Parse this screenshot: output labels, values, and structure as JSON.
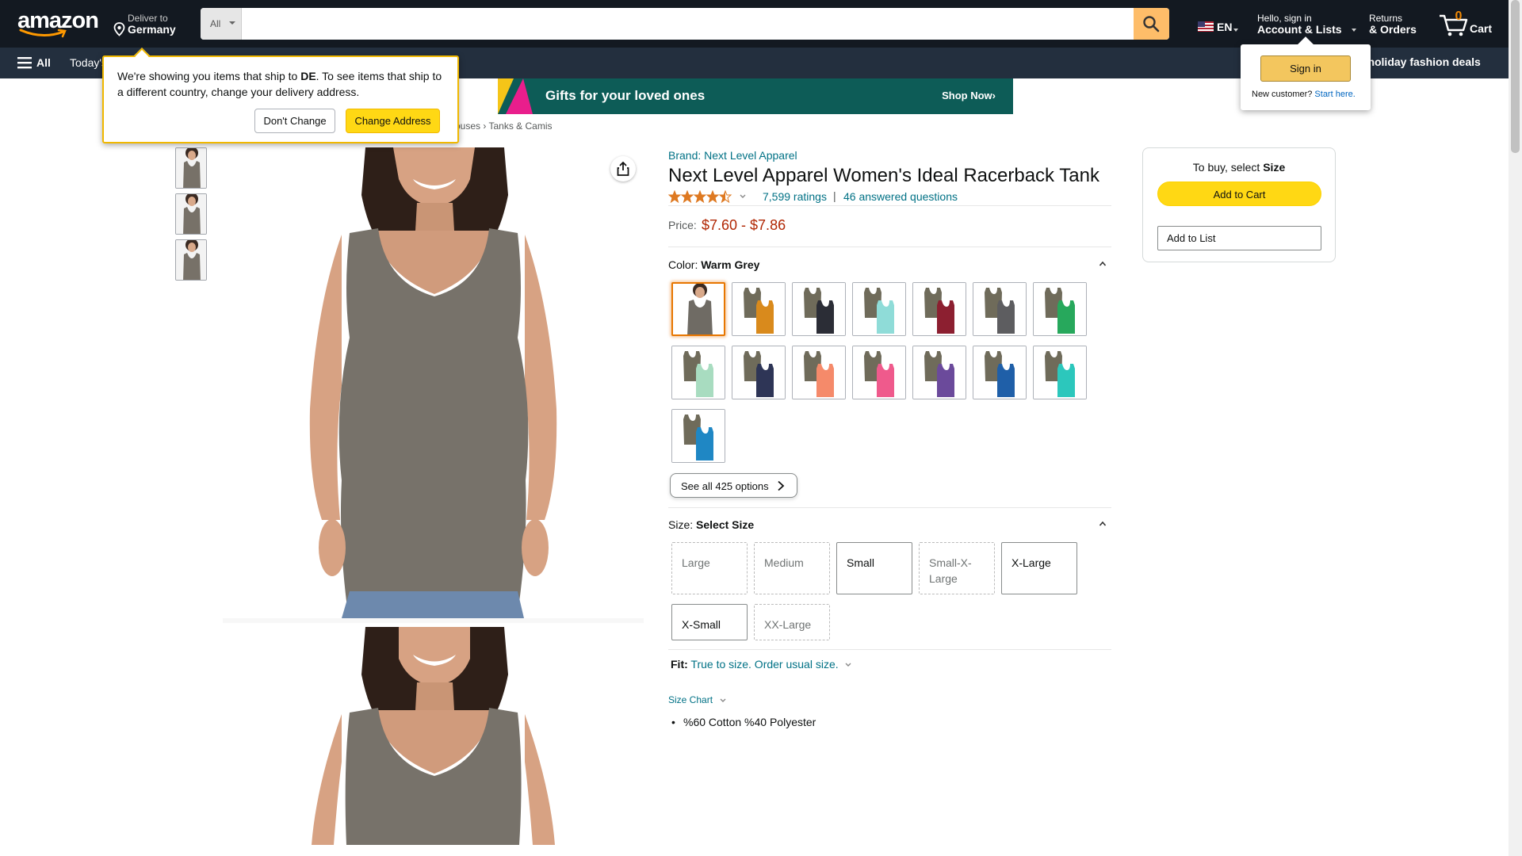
{
  "header": {
    "logo_text": "amazon",
    "deliver_line1": "Deliver to",
    "deliver_line2": "Germany",
    "search_dept": "All",
    "search_placeholder": "",
    "lang": "EN",
    "account_line1": "Hello, sign in",
    "account_line2": "Account & Lists",
    "returns_line1": "Returns",
    "returns_line2": "& Orders",
    "cart_count": "0",
    "cart_label": "Cart"
  },
  "subnav": {
    "all_label": "All",
    "today_label": "Today's",
    "deals_label": "p holiday fashion deals"
  },
  "promo": {
    "text": "Gifts for your loved ones",
    "cta": "Shop Now›"
  },
  "breadcrumb": "ouses › Tanks & Camis",
  "ship_popover": {
    "msg_prefix": "We're showing you items that ship to ",
    "country": "DE",
    "msg_suffix": ". To see items that ship to a different country, change your delivery address.",
    "dont_change": "Don't Change",
    "change_address": "Change Address"
  },
  "signin_popover": {
    "button": "Sign in",
    "new_customer": "New customer?",
    "start_here": "Start here."
  },
  "product": {
    "brand": "Brand: Next Level Apparel",
    "title": "Next Level Apparel Women's Ideal Racerback Tank",
    "rating_stars": 4.5,
    "ratings": "7,599 ratings",
    "separator": "|",
    "questions": "46 answered questions",
    "price_label": "Price:",
    "price": "$7.60 - $7.86",
    "color_label": "Color: ",
    "color_value": "Warm Grey",
    "see_all": "See all 425 options",
    "size_label": "Size: ",
    "size_value": "Select Size",
    "sizes": [
      {
        "label": "Large",
        "available": false
      },
      {
        "label": "Medium",
        "available": false
      },
      {
        "label": "Small",
        "available": true
      },
      {
        "label": "Small-X-Large",
        "available": false
      },
      {
        "label": "X-Large",
        "available": true
      },
      {
        "label": "X-Small",
        "available": true
      },
      {
        "label": "XX-Large",
        "available": false
      }
    ],
    "fit_label": "Fit:",
    "fit_value": "True to size. Order usual size.",
    "size_chart": "Size Chart",
    "material": "%60 Cotton %40 Polyester",
    "swatch_colors": [
      "#6f6b64",
      "#d98a1c",
      "#2b2d36",
      "#8fdcd8",
      "#8c1f30",
      "#5d5d60",
      "#27a85c",
      "#a8dcc0",
      "#2e3556",
      "#f58a6a",
      "#ef5a8c",
      "#6b4a9b",
      "#1f5fa8",
      "#2cc7bc",
      "#1f87c4"
    ]
  },
  "buybox": {
    "hint_prefix": "To buy, select ",
    "hint_bold": "Size",
    "add_to_cart": "Add to Cart",
    "add_to_list": "Add to List"
  }
}
